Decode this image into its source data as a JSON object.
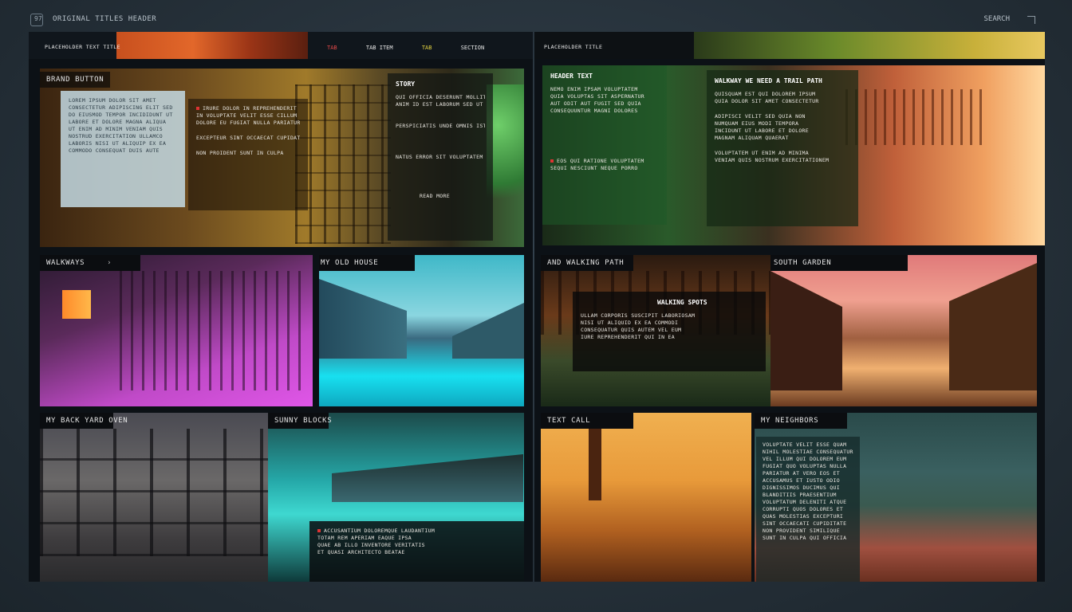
{
  "window": {
    "app_title": "ORIGINAL TITLES HEADER",
    "top_right_label": "SEARCH",
    "version_badge": "97"
  },
  "left_board": {
    "brand": "PLACEHOLDER TEXT TITLE",
    "nav": [
      "TAB",
      "TAB ITEM",
      "TAB",
      "SECTION"
    ],
    "hero": {
      "section_label": "BRAND BUTTON",
      "text_block": {
        "lines": [
          "LOREM IPSUM DOLOR SIT AMET",
          "CONSECTETUR ADIPISCING ELIT SED",
          "DO EIUSMOD TEMPOR INCIDIDUNT UT",
          "LABORE ET DOLORE MAGNA ALIQUA",
          "UT ENIM AD MINIM VENIAM QUIS",
          "NOSTRUD EXERCITATION ULLAMCO",
          "LABORIS NISI UT ALIQUIP EX EA",
          "COMMODO CONSEQUAT DUIS AUTE"
        ]
      },
      "mid_lines": [
        "IRURE DOLOR IN REPREHENDERIT",
        "IN VOLUPTATE VELIT ESSE CILLUM",
        "DOLORE EU FUGIAT NULLA PARIATUR",
        "EXCEPTEUR SINT OCCAECAT CUPIDATAT",
        "NON PROIDENT SUNT IN CULPA"
      ],
      "side_label": "STORY",
      "side_lines": [
        "QUI OFFICIA DESERUNT MOLLIT",
        "ANIM ID EST LABORUM SED UT",
        "PERSPICIATIS UNDE OMNIS ISTE",
        "NATUS ERROR SIT VOLUPTATEM"
      ],
      "caption": "READ MORE"
    },
    "cards": [
      {
        "label": "WALKWAYS",
        "arrow": "›"
      },
      {
        "label": "MY OLD HOUSE"
      },
      {
        "label": "MY BACK YARD OVEN"
      },
      {
        "label": "SUNNY BLOCKS"
      }
    ],
    "train_caption": {
      "lines": [
        "ACCUSANTIUM DOLOREMQUE LAUDANTIUM",
        "TOTAM REM APERIAM EAQUE IPSA",
        "QUAE AB ILLO INVENTORE VERITATIS",
        "ET QUASI ARCHITECTO BEATAE"
      ]
    }
  },
  "right_board": {
    "brand": "PLACEHOLDER TITLE",
    "hero": {
      "label": "HEADER TEXT",
      "text_lines": [
        "NEMO ENIM IPSAM VOLUPTATEM",
        "QUIA VOLUPTAS SIT ASPERNATUR",
        "AUT ODIT AUT FUGIT SED QUIA",
        "CONSEQUUNTUR MAGNI DOLORES",
        "EOS QUI RATIONE VOLUPTATEM",
        "SEQUI NESCIUNT NEQUE PORRO"
      ],
      "center_heading": "WALKWAY WE NEED A TRAIL PATH",
      "center_lines": [
        "QUISQUAM EST QUI DOLOREM IPSUM",
        "QUIA DOLOR SIT AMET CONSECTETUR",
        "ADIPISCI VELIT SED QUIA NON",
        "NUMQUAM EIUS MODI TEMPORA",
        "INCIDUNT UT LABORE ET DOLORE",
        "MAGNAM ALIQUAM QUAERAT",
        "VOLUPTATEM UT ENIM AD MINIMA",
        "VENIAM QUIS NOSTRUM EXERCITATIONEM"
      ]
    },
    "cards": [
      {
        "label": "AND WALKING PATH"
      },
      {
        "label": "SOUTH GARDEN"
      },
      {
        "label": "TEXT CALL"
      },
      {
        "label": "MY NEIGHBORS"
      }
    ],
    "middle_box": {
      "heading": "WALKING SPOTS",
      "lines": [
        "ULLAM CORPORIS SUSCIPIT LABORIOSAM",
        "NISI UT ALIQUID EX EA COMMODI",
        "CONSEQUATUR QUIS AUTEM VEL EUM",
        "IURE REPREHENDERIT QUI IN EA"
      ]
    },
    "list_box": {
      "lines": [
        "VOLUPTATE VELIT ESSE QUAM",
        "NIHIL MOLESTIAE CONSEQUATUR",
        "VEL ILLUM QUI DOLOREM EUM",
        "FUGIAT QUO VOLUPTAS NULLA",
        "PARIATUR AT VERO EOS ET",
        "ACCUSAMUS ET IUSTO ODIO",
        "DIGNISSIMOS DUCIMUS QUI",
        "BLANDITIIS PRAESENTIUM",
        "VOLUPTATUM DELENITI ATQUE",
        "CORRUPTI QUOS DOLORES ET",
        "QUAS MOLESTIAS EXCEPTURI",
        "SINT OCCAECATI CUPIDITATE",
        "NON PROVIDENT SIMILIQUE",
        "SUNT IN CULPA QUI OFFICIA"
      ]
    }
  },
  "colors": {
    "accent_red": "#d33a3a",
    "tag_background": "#0b0d10"
  }
}
